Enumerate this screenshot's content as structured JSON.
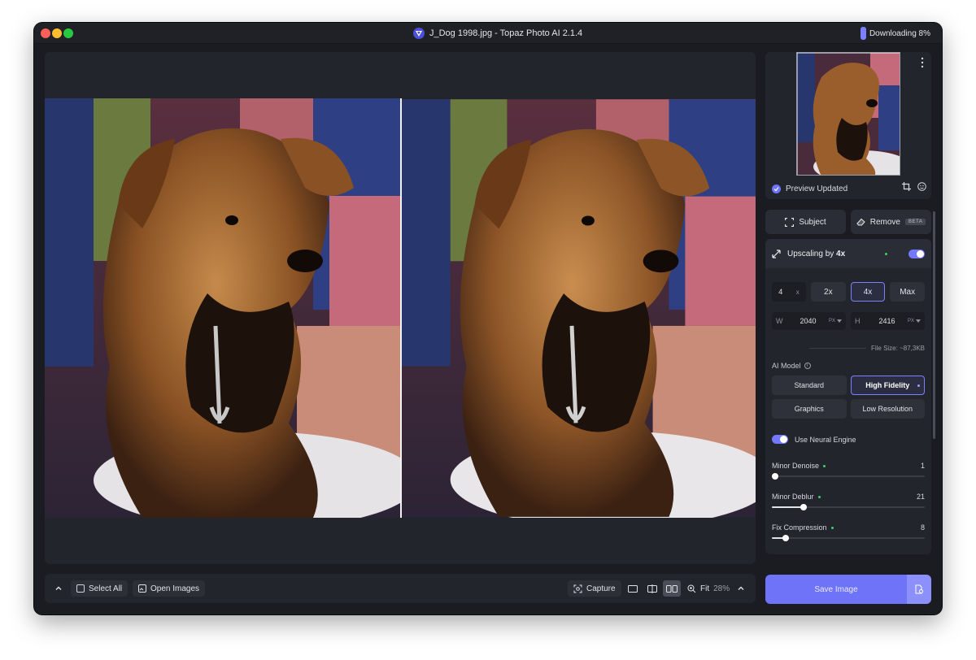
{
  "window": {
    "title": "J_Dog 1998.jpg - Topaz Photo AI 2.1.4",
    "download_status": "Downloading 8%"
  },
  "preview": {
    "status": "Preview Updated"
  },
  "tools": {
    "subject_label": "Subject",
    "remove_label": "Remove",
    "remove_badge": "BETA"
  },
  "upscaling": {
    "title_prefix": "Upscaling by ",
    "title_value": "4x",
    "enabled": true,
    "scale_value": "4",
    "scale_unit": "x",
    "options": [
      "2x",
      "4x",
      "Max"
    ],
    "selected_option": "4x",
    "width_label": "W",
    "width_value": "2040",
    "height_label": "H",
    "height_value": "2416",
    "unit": "PX",
    "file_size": "File Size: ~87,3KB"
  },
  "ai_model": {
    "label": "AI Model",
    "models": [
      "Standard",
      "High Fidelity",
      "Graphics",
      "Low Resolution"
    ],
    "selected": "High Fidelity"
  },
  "neural_engine": {
    "label": "Use Neural Engine",
    "enabled": true
  },
  "sliders": [
    {
      "name": "Minor Denoise",
      "value": "1",
      "fraction": 0.02
    },
    {
      "name": "Minor Deblur",
      "value": "21",
      "fraction": 0.21
    },
    {
      "name": "Fix Compression",
      "value": "8",
      "fraction": 0.09
    }
  ],
  "bottom_bar": {
    "select_all": "Select All",
    "open_images": "Open Images",
    "capture": "Capture",
    "fit_label": "Fit",
    "zoom": "28%"
  },
  "actions": {
    "save": "Save Image"
  },
  "colors": {
    "accent": "#6f73f7",
    "status_green": "#3ad46a"
  }
}
